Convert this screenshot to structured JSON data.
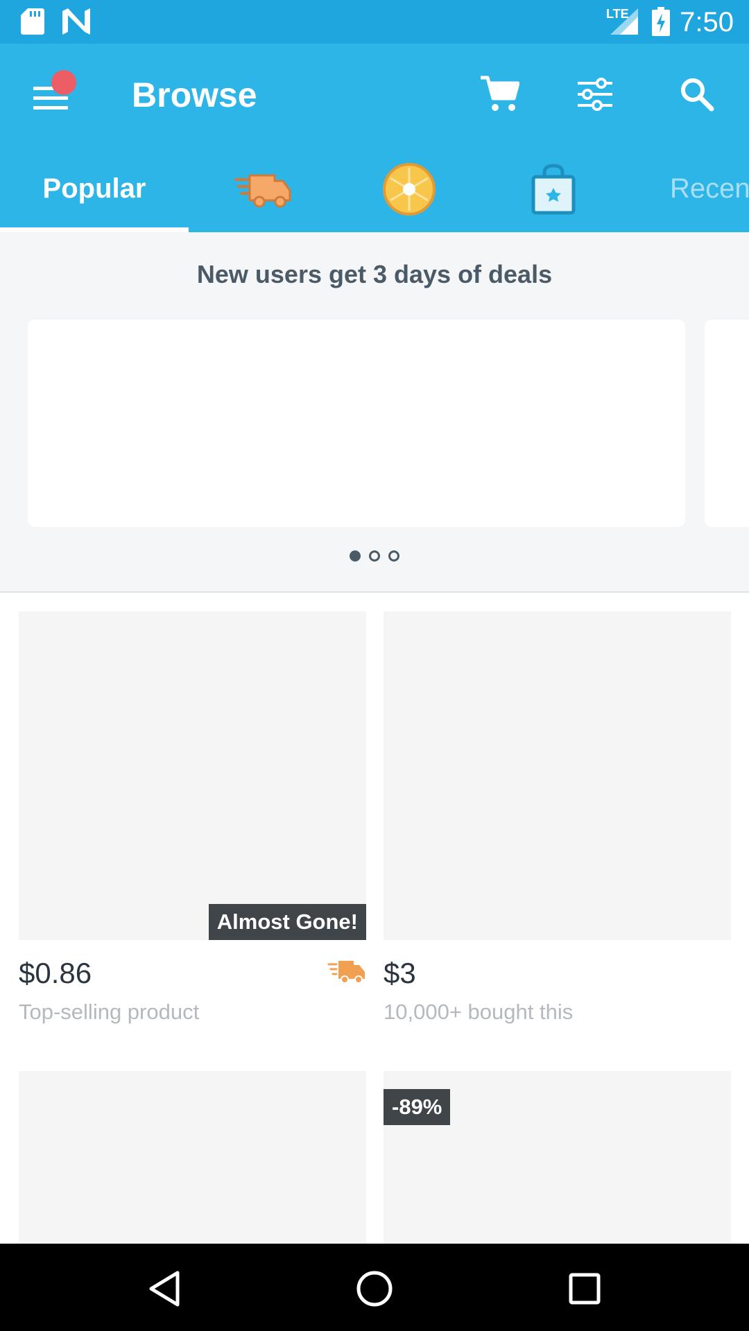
{
  "status_bar": {
    "time": "7:50",
    "network": "LTE",
    "icons": [
      "sd-card-icon",
      "n-logo-icon",
      "signal-icon",
      "battery-charging-icon"
    ]
  },
  "header": {
    "title": "Browse",
    "menu_has_notification": true,
    "actions": [
      "cart-icon",
      "filter-icon",
      "search-icon"
    ]
  },
  "tabs": {
    "popular_label": "Popular",
    "recent_label": "Recen",
    "icon_tabs": [
      "fast-shipping-tab",
      "blitz-buy-tab",
      "local-store-tab"
    ],
    "selected": "Popular"
  },
  "promo": {
    "title": "New users get 3 days of deals",
    "page_count": 3,
    "active_page": 1
  },
  "products": [
    {
      "price": "$0.86",
      "subtitle": "Top-selling product",
      "badge": "Almost Gone!",
      "fast_shipping": true
    },
    {
      "price": "$3",
      "subtitle": "10,000+ bought this",
      "badge": "",
      "fast_shipping": false
    },
    {
      "price": "",
      "subtitle": "",
      "badge": "",
      "fast_shipping": false
    },
    {
      "price": "",
      "subtitle": "",
      "badge": "-89%",
      "fast_shipping": false
    }
  ],
  "colors": {
    "status_bar": "#1fa6de",
    "app_bar": "#2eb5e8",
    "notification_dot": "#ec5d66",
    "shipping_orange": "#f0a050",
    "badge_bg": "#3f4548"
  }
}
